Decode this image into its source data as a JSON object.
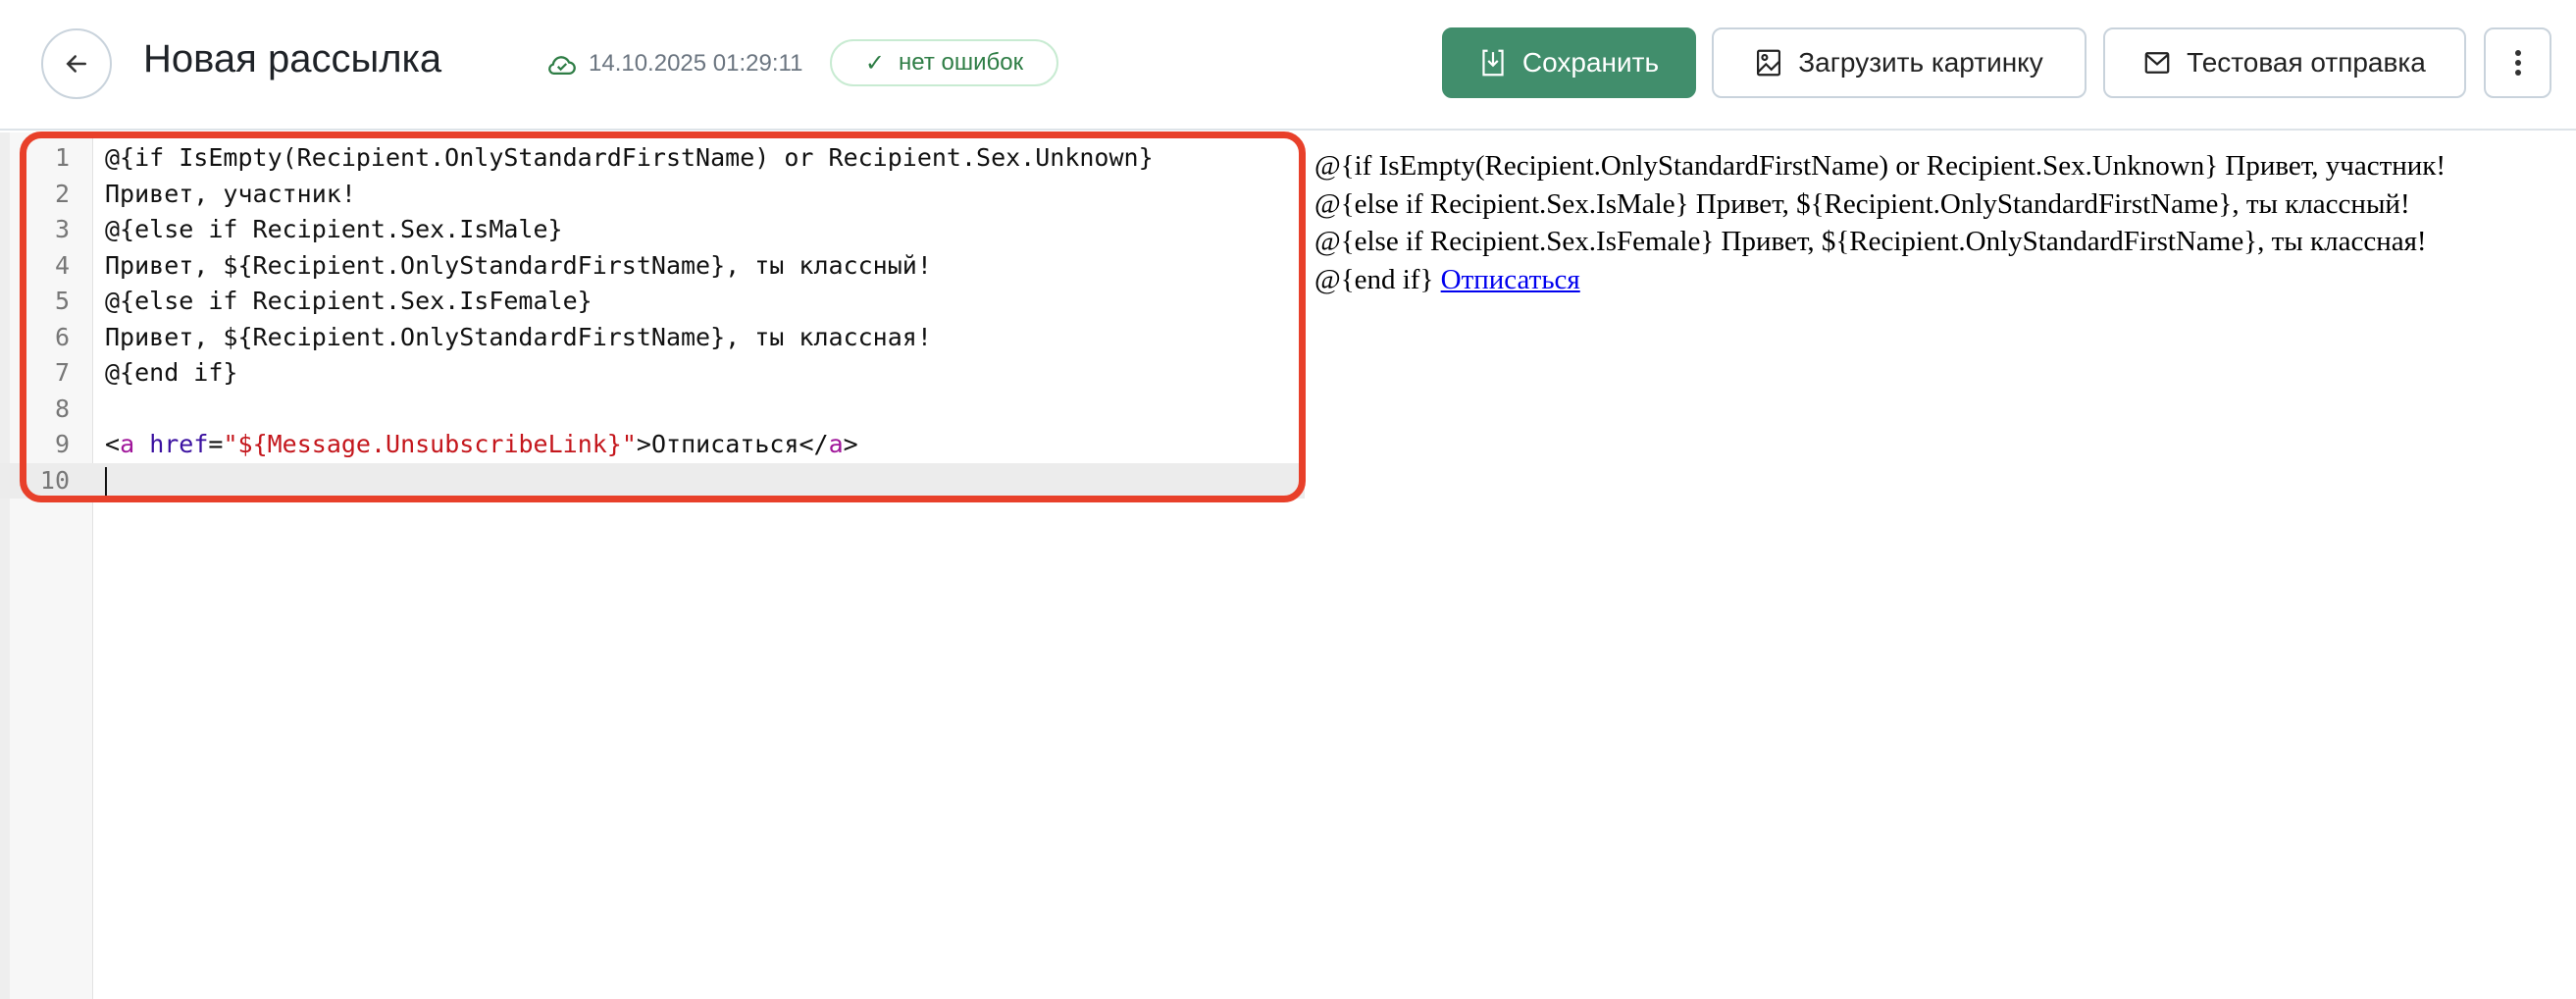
{
  "header": {
    "title": "Новая рассылка",
    "saved_time": "14.10.2025 01:29:11",
    "status_badge": "нет ошибок",
    "buttons": {
      "save": "Сохранить",
      "upload_image": "Загрузить картинку",
      "test_send": "Тестовая отправка"
    }
  },
  "editor": {
    "lines": [
      {
        "n": "1",
        "text": "@{if IsEmpty(Recipient.OnlyStandardFirstName) or Recipient.Sex.Unknown}"
      },
      {
        "n": "2",
        "text": "Привет, участник!"
      },
      {
        "n": "3",
        "text": "@{else if Recipient.Sex.IsMale}"
      },
      {
        "n": "4",
        "text": "Привет, ${Recipient.OnlyStandardFirstName}, ты классный!"
      },
      {
        "n": "5",
        "text": "@{else if Recipient.Sex.IsFemale}"
      },
      {
        "n": "6",
        "text": "Привет, ${Recipient.OnlyStandardFirstName}, ты классная!"
      },
      {
        "n": "7",
        "text": "@{end if}"
      },
      {
        "n": "8",
        "text": ""
      },
      {
        "n": "9",
        "parts": {
          "lt": "<",
          "tag": "a",
          "sp": " ",
          "attr": "href",
          "eq": "=",
          "str": "\"${Message.UnsubscribeLink}\"",
          "gt": ">",
          "content": "Отписаться",
          "close_lt": "</",
          "close_tag": "a",
          "close_gt": ">"
        }
      },
      {
        "n": "10",
        "text": ""
      }
    ]
  },
  "preview": {
    "lines": [
      "@{if IsEmpty(Recipient.OnlyStandardFirstName) or Recipient.Sex.Unknown} Привет, участник!",
      "@{else if Recipient.Sex.IsMale} Привет, ${Recipient.OnlyStandardFirstName}, ты классный!",
      "@{else if Recipient.Sex.IsFemale} Привет, ${Recipient.OnlyStandardFirstName}, ты классная!"
    ],
    "last_prefix": "@{end if} ",
    "link": "Отписаться"
  },
  "colors": {
    "primary": "#418e6c",
    "highlight": "#e8402a",
    "success": "#2e7d45"
  }
}
